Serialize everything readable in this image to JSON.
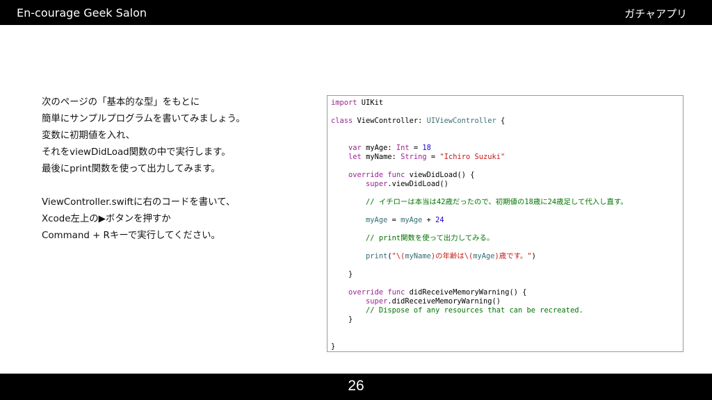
{
  "header": {
    "brand": "En-courage Geek Salon",
    "series": "ガチャアプリ"
  },
  "instructions": {
    "lines": [
      "次のページの「基本的な型」をもとに",
      "簡単にサンプルプログラムを書いてみましょう。",
      "変数に初期値を入れ、",
      "それをviewDidLoad関数の中で実行します。",
      "最後にprint関数を使って出力してみます。",
      "ViewController.swiftに右のコードを書いて、",
      "Xcode左上の▶ボタンを押すか",
      "Command + Rキーで実行してください。"
    ]
  },
  "code": {
    "import_kw": "import",
    "import_mod": " UIKit",
    "class_kw": "class",
    "class_name": " ViewController: ",
    "superclass": "UIViewController",
    "class_open": " {",
    "var_kw": "var",
    "var_name": " myAge: ",
    "int_type": "Int",
    "eq": " = ",
    "age_value": "18",
    "let_kw": "let",
    "let_name": " myName: ",
    "string_type": "String",
    "name_value": "\"Ichiro Suzuki\"",
    "override_kw": "override",
    "func_kw": "func",
    "vdl_sig": " viewDidLoad() {",
    "super_kw": "super",
    "super_vdl": ".viewDidLoad()",
    "comment_1": "// イチローは本当は42歳だったので、初期値の18歳に24歳足して代入し直す。",
    "myage_a": "myAge",
    "assign_eq": " = ",
    "myage_b": "myAge",
    "plus": " + ",
    "add_value": "24",
    "comment_2": "// print関数を使って出力してみる。",
    "print_fn": "print",
    "print_open": "(",
    "str_q1": "\"\\(",
    "interp_name": "myName",
    "str_mid": ")の年齢は\\(",
    "interp_age": "myAge",
    "str_end": ")歳です。\"",
    "print_close": ")",
    "close_brace": "}",
    "didrec_sig": " didReceiveMemoryWarning() {",
    "super_didrec": ".didReceiveMemoryWarning()",
    "comment_3": "// Dispose of any resources that can be recreated.",
    "close_class": "}"
  },
  "footer": {
    "page_number": "26"
  }
}
